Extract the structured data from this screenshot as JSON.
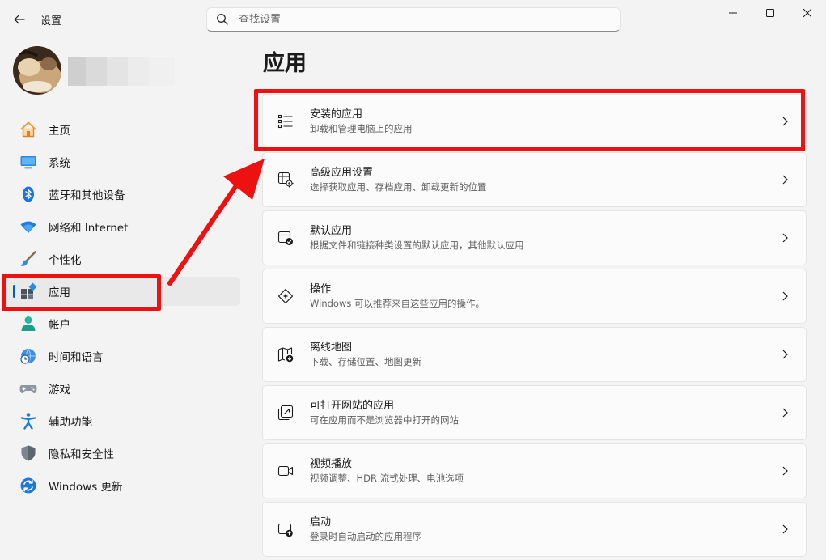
{
  "window": {
    "title": "设置"
  },
  "search": {
    "placeholder": "查找设置"
  },
  "sidebar": {
    "items": [
      {
        "label": "主页",
        "icon": "home-icon"
      },
      {
        "label": "系统",
        "icon": "system-display-icon"
      },
      {
        "label": "蓝牙和其他设备",
        "icon": "bluetooth-icon"
      },
      {
        "label": "网络和 Internet",
        "icon": "wifi-icon"
      },
      {
        "label": "个性化",
        "icon": "paintbrush-icon"
      },
      {
        "label": "应用",
        "icon": "apps-icon",
        "selected": true
      },
      {
        "label": "帐户",
        "icon": "account-icon"
      },
      {
        "label": "时间和语言",
        "icon": "globe-clock-icon"
      },
      {
        "label": "游戏",
        "icon": "gamepad-icon"
      },
      {
        "label": "辅助功能",
        "icon": "accessibility-icon"
      },
      {
        "label": "隐私和安全性",
        "icon": "shield-icon"
      },
      {
        "label": "Windows 更新",
        "icon": "update-icon"
      }
    ]
  },
  "main": {
    "title": "应用",
    "cards": [
      {
        "title": "安装的应用",
        "subtitle": "卸载和管理电脑上的应用",
        "icon": "list-icon"
      },
      {
        "title": "高级应用设置",
        "subtitle": "选择获取应用、存档应用、卸载更新的位置",
        "icon": "app-settings-icon"
      },
      {
        "title": "默认应用",
        "subtitle": "根据文件和链接种类设置的默认应用，其他默认应用",
        "icon": "default-apps-icon"
      },
      {
        "title": "操作",
        "subtitle": "Windows 可以推荐来自这些应用的操作。",
        "icon": "actions-icon"
      },
      {
        "title": "离线地图",
        "subtitle": "下载、存储位置、地图更新",
        "icon": "offline-map-icon"
      },
      {
        "title": "可打开网站的应用",
        "subtitle": "可在应用而不是浏览器中打开的网站",
        "icon": "open-website-icon"
      },
      {
        "title": "视频播放",
        "subtitle": "视频调整、HDR 流式处理、电池选项",
        "icon": "video-camera-icon"
      },
      {
        "title": "启动",
        "subtitle": "登录时自动启动的应用程序",
        "icon": "startup-icon"
      }
    ]
  },
  "colors": {
    "accent": "#005fb8",
    "highlight": "#ee1111",
    "background": "#f3f3f3",
    "card": "#fbfbfb"
  }
}
